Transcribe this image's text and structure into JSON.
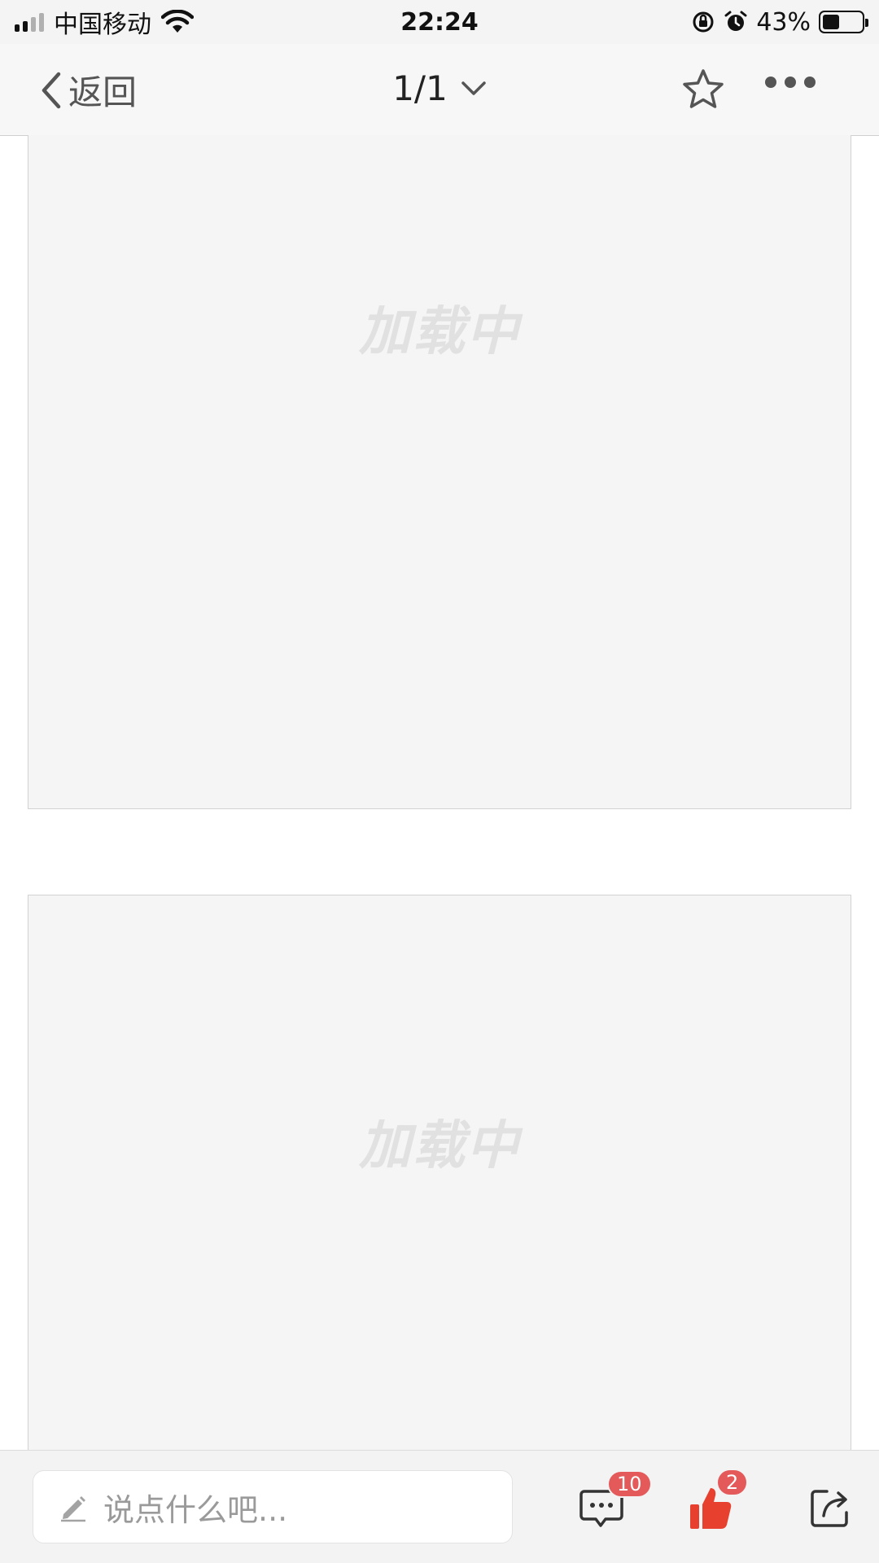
{
  "status_bar": {
    "carrier": "中国移动",
    "time": "22:24",
    "battery_percent": "43%",
    "battery_level": 0.43
  },
  "nav": {
    "back_label": "返回",
    "page_indicator": "1/1"
  },
  "content": {
    "panels": [
      {
        "loading_text": "加载中"
      },
      {
        "loading_text": "加载中"
      }
    ]
  },
  "bottom_bar": {
    "comment_placeholder": "说点什么吧...",
    "comment_count": "10",
    "like_count": "2"
  },
  "colors": {
    "accent_red": "#e8402f",
    "badge_red": "#e45a5a",
    "icon_gray": "#555555"
  }
}
